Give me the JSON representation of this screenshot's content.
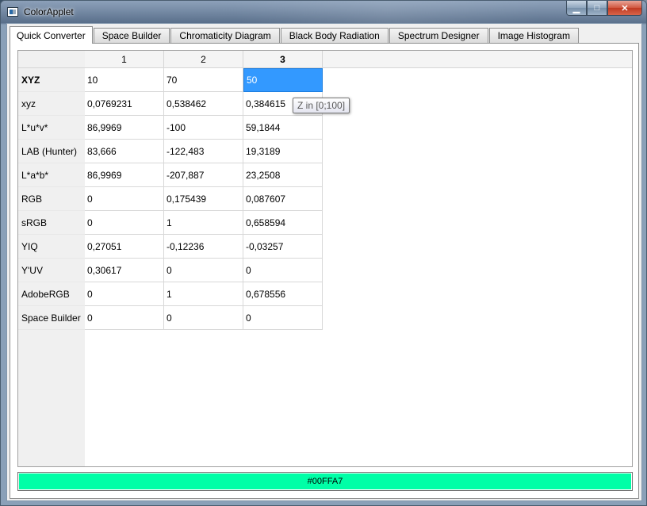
{
  "window": {
    "title": "ColorApplet",
    "controls": {
      "minimize": "▁",
      "maximize": "□",
      "close": "✕"
    }
  },
  "tabs": [
    {
      "label": "Quick Converter",
      "active": true
    },
    {
      "label": "Space Builder",
      "active": false
    },
    {
      "label": "Chromaticity Diagram",
      "active": false
    },
    {
      "label": "Black Body Radiation",
      "active": false
    },
    {
      "label": "Spectrum Designer",
      "active": false
    },
    {
      "label": "Image Histogram",
      "active": false
    }
  ],
  "table": {
    "columns": [
      "1",
      "2",
      "3"
    ],
    "rows": [
      {
        "label": "XYZ",
        "values": [
          "10",
          "70",
          "50"
        ]
      },
      {
        "label": "xyz",
        "values": [
          "0,0769231",
          "0,538462",
          "0,384615"
        ]
      },
      {
        "label": "L*u*v*",
        "values": [
          "86,9969",
          "-100",
          "59,1844"
        ]
      },
      {
        "label": "LAB (Hunter)",
        "values": [
          "83,666",
          "-122,483",
          "19,3189"
        ]
      },
      {
        "label": "L*a*b*",
        "values": [
          "86,9969",
          "-207,887",
          "23,2508"
        ]
      },
      {
        "label": "RGB",
        "values": [
          "0",
          "0,175439",
          "0,087607"
        ]
      },
      {
        "label": "sRGB",
        "values": [
          "0",
          "1",
          "0,658594"
        ]
      },
      {
        "label": "YIQ",
        "values": [
          "0,27051",
          "-0,12236",
          "-0,03257"
        ]
      },
      {
        "label": "Y'UV",
        "values": [
          "0,30617",
          "0",
          "0"
        ]
      },
      {
        "label": "AdobeRGB",
        "values": [
          "0",
          "1",
          "0,678556"
        ]
      },
      {
        "label": "Space Builder",
        "values": [
          "0",
          "0",
          "0"
        ]
      }
    ]
  },
  "tooltip": {
    "text": "Z in [0;100]"
  },
  "color_bar": {
    "label": "#00FFA7",
    "color": "#00FFA7"
  },
  "colors": {
    "selection": "#3399ff",
    "title_bg": "#5f768f"
  }
}
